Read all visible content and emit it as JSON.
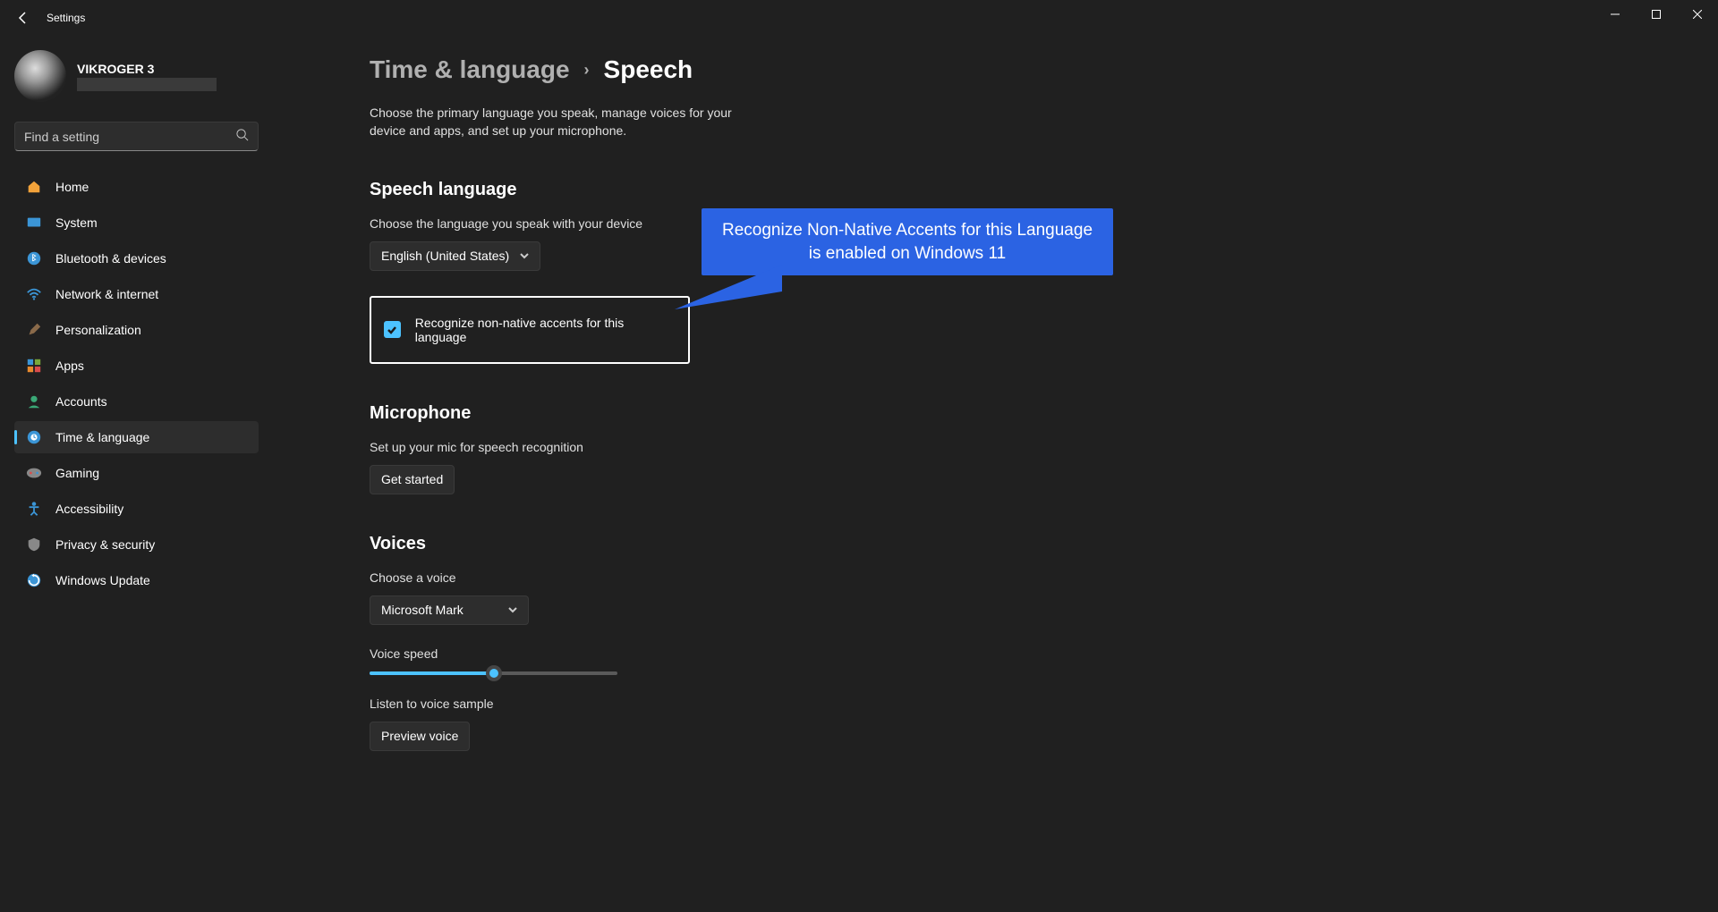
{
  "window": {
    "title": "Settings"
  },
  "profile": {
    "name": "VIKROGER 3"
  },
  "search": {
    "placeholder": "Find a setting"
  },
  "nav": {
    "home": "Home",
    "system": "System",
    "bluetooth": "Bluetooth & devices",
    "network": "Network & internet",
    "personalization": "Personalization",
    "apps": "Apps",
    "accounts": "Accounts",
    "time_language": "Time & language",
    "gaming": "Gaming",
    "accessibility": "Accessibility",
    "privacy": "Privacy & security",
    "update": "Windows Update"
  },
  "breadcrumb": {
    "parent": "Time & language",
    "current": "Speech"
  },
  "page_desc": "Choose the primary language you speak, manage voices for your device and apps, and set up your microphone.",
  "speech_language": {
    "heading": "Speech language",
    "sub": "Choose the language you speak with your device",
    "selected": "English (United States)",
    "checkbox_label": "Recognize non-native accents for this language"
  },
  "microphone": {
    "heading": "Microphone",
    "sub": "Set up your mic for speech recognition",
    "button": "Get started"
  },
  "voices": {
    "heading": "Voices",
    "sub": "Choose a voice",
    "selected": "Microsoft Mark",
    "speed_label": "Voice speed",
    "listen_label": "Listen to voice sample",
    "preview_button": "Preview voice"
  },
  "callout": {
    "line1": "Recognize Non-Native Accents for this Language",
    "line2": "is enabled on Windows 11"
  }
}
